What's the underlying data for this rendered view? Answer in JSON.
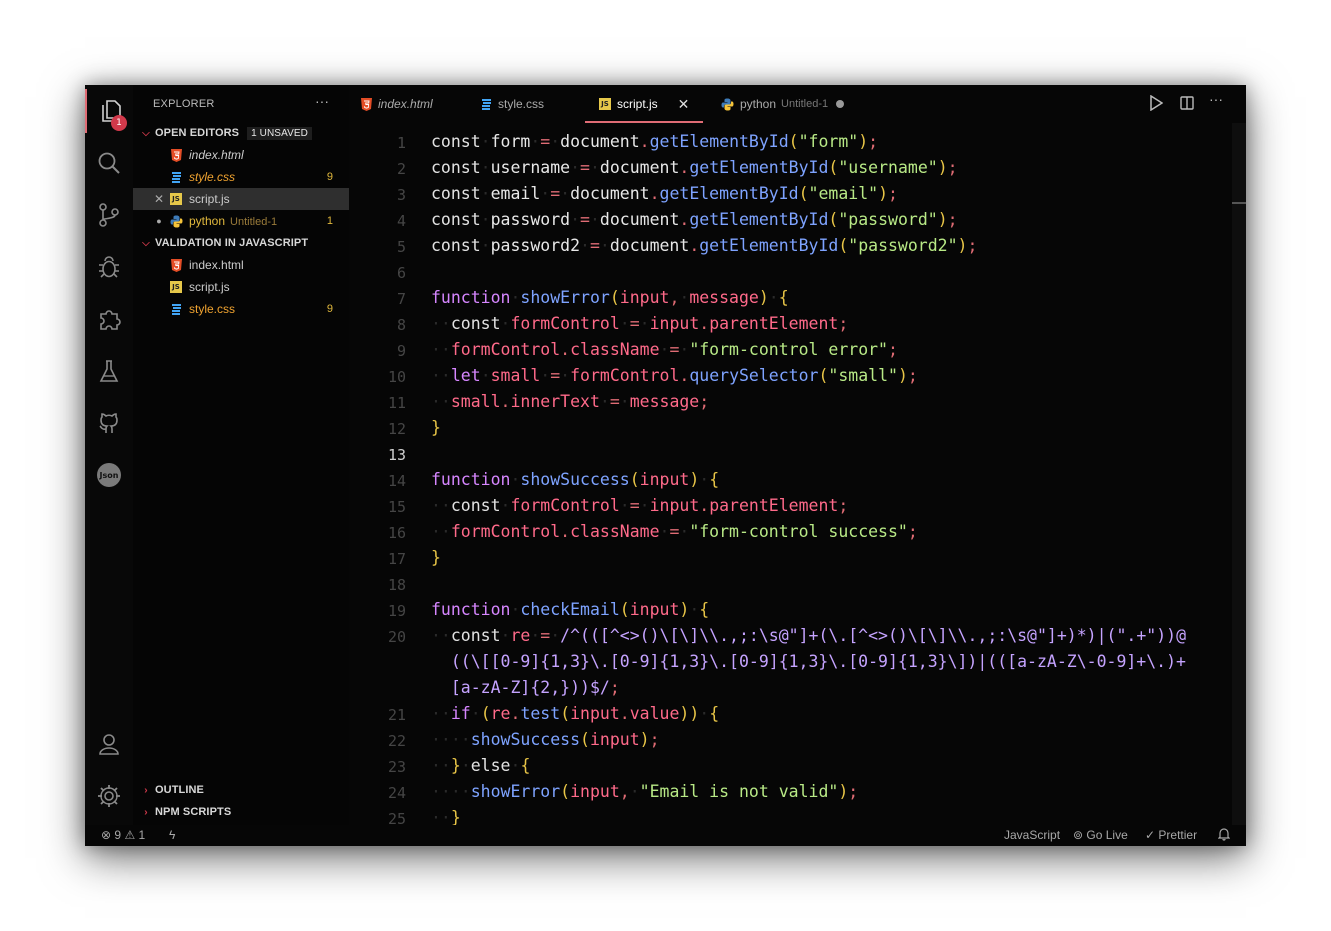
{
  "sidebar": {
    "title": "EXPLORER",
    "more": "···",
    "open_editors": {
      "label": "OPEN EDITORS",
      "unsaved": "1 UNSAVED",
      "items": [
        {
          "name": "index.html",
          "count": ""
        },
        {
          "name": "style.css",
          "count": "9"
        },
        {
          "name": "script.js",
          "count": ""
        },
        {
          "name": "python",
          "sub": "Untitled-1",
          "count": "1"
        }
      ]
    },
    "project": {
      "label": "VALIDATION IN JAVASCRIPT",
      "items": [
        {
          "name": "index.html",
          "count": ""
        },
        {
          "name": "script.js",
          "count": ""
        },
        {
          "name": "style.css",
          "count": "9"
        }
      ]
    },
    "outline": "OUTLINE",
    "npm": "NPM SCRIPTS"
  },
  "activity": {
    "badge": "1",
    "json_label": "Json"
  },
  "tabs": [
    {
      "name": "index.html"
    },
    {
      "name": "style.css"
    },
    {
      "name": "script.js",
      "close": "✕"
    },
    {
      "name": "python",
      "sub": "Untitled-1"
    }
  ],
  "toolbar": {
    "more": "···"
  },
  "editor": {
    "current_line": 13,
    "gutter": [
      "1",
      "2",
      "3",
      "4",
      "5",
      "6",
      "7",
      "8",
      "9",
      "10",
      "11",
      "12",
      "13",
      "14",
      "15",
      "16",
      "17",
      "18",
      "19",
      "20",
      "",
      "",
      "21",
      "22",
      "23",
      "24",
      "25"
    ],
    "lines": [
      [
        [
          "k",
          "const"
        ],
        [
          "ws",
          "·"
        ],
        [
          "e",
          "form"
        ],
        [
          "ws",
          "·"
        ],
        [
          "o",
          "="
        ],
        [
          "ws",
          "·"
        ],
        [
          "e",
          "document"
        ],
        [
          "o",
          "."
        ],
        [
          "m",
          "getElementById"
        ],
        [
          "p",
          "("
        ],
        [
          "s",
          "\"form\""
        ],
        [
          "p",
          ")"
        ],
        [
          "o",
          ";"
        ]
      ],
      [
        [
          "k",
          "const"
        ],
        [
          "ws",
          "·"
        ],
        [
          "e",
          "username"
        ],
        [
          "ws",
          "·"
        ],
        [
          "o",
          "="
        ],
        [
          "ws",
          "·"
        ],
        [
          "e",
          "document"
        ],
        [
          "o",
          "."
        ],
        [
          "m",
          "getElementById"
        ],
        [
          "p",
          "("
        ],
        [
          "s",
          "\"username\""
        ],
        [
          "p",
          ")"
        ],
        [
          "o",
          ";"
        ]
      ],
      [
        [
          "k",
          "const"
        ],
        [
          "ws",
          "·"
        ],
        [
          "e",
          "email"
        ],
        [
          "ws",
          "·"
        ],
        [
          "o",
          "="
        ],
        [
          "ws",
          "·"
        ],
        [
          "e",
          "document"
        ],
        [
          "o",
          "."
        ],
        [
          "m",
          "getElementById"
        ],
        [
          "p",
          "("
        ],
        [
          "s",
          "\"email\""
        ],
        [
          "p",
          ")"
        ],
        [
          "o",
          ";"
        ]
      ],
      [
        [
          "k",
          "const"
        ],
        [
          "ws",
          "·"
        ],
        [
          "e",
          "password"
        ],
        [
          "ws",
          "·"
        ],
        [
          "o",
          "="
        ],
        [
          "ws",
          "·"
        ],
        [
          "e",
          "document"
        ],
        [
          "o",
          "."
        ],
        [
          "m",
          "getElementById"
        ],
        [
          "p",
          "("
        ],
        [
          "s",
          "\"password\""
        ],
        [
          "p",
          ")"
        ],
        [
          "o",
          ";"
        ]
      ],
      [
        [
          "k",
          "const"
        ],
        [
          "ws",
          "·"
        ],
        [
          "e",
          "password2"
        ],
        [
          "ws",
          "·"
        ],
        [
          "o",
          "="
        ],
        [
          "ws",
          "·"
        ],
        [
          "e",
          "document"
        ],
        [
          "o",
          "."
        ],
        [
          "m",
          "getElementById"
        ],
        [
          "p",
          "("
        ],
        [
          "s",
          "\"password2\""
        ],
        [
          "p",
          ")"
        ],
        [
          "o",
          ";"
        ]
      ],
      [],
      [
        [
          "fn",
          "function"
        ],
        [
          "ws",
          "·"
        ],
        [
          "m",
          "showError"
        ],
        [
          "p",
          "("
        ],
        [
          "v",
          "input"
        ],
        [
          "o",
          ","
        ],
        [
          "ws",
          "·"
        ],
        [
          "v",
          "message"
        ],
        [
          "p",
          ")"
        ],
        [
          "ws",
          "·"
        ],
        [
          "p",
          "{"
        ]
      ],
      [
        [
          "ws",
          "··"
        ],
        [
          "k",
          "const"
        ],
        [
          "ws",
          "·"
        ],
        [
          "v",
          "formControl"
        ],
        [
          "ws",
          "·"
        ],
        [
          "o",
          "="
        ],
        [
          "ws",
          "·"
        ],
        [
          "v",
          "input"
        ],
        [
          "o",
          "."
        ],
        [
          "v",
          "parentElement"
        ],
        [
          "o",
          ";"
        ]
      ],
      [
        [
          "ws",
          "··"
        ],
        [
          "v",
          "formControl"
        ],
        [
          "o",
          "."
        ],
        [
          "v",
          "className"
        ],
        [
          "ws",
          "·"
        ],
        [
          "o",
          "="
        ],
        [
          "ws",
          "·"
        ],
        [
          "s",
          "\"form-control error\""
        ],
        [
          "o",
          ";"
        ]
      ],
      [
        [
          "ws",
          "··"
        ],
        [
          "fn",
          "let"
        ],
        [
          "ws",
          "·"
        ],
        [
          "v",
          "small"
        ],
        [
          "ws",
          "·"
        ],
        [
          "o",
          "="
        ],
        [
          "ws",
          "·"
        ],
        [
          "v",
          "formControl"
        ],
        [
          "o",
          "."
        ],
        [
          "m",
          "querySelector"
        ],
        [
          "p",
          "("
        ],
        [
          "s",
          "\"small\""
        ],
        [
          "p",
          ")"
        ],
        [
          "o",
          ";"
        ]
      ],
      [
        [
          "ws",
          "··"
        ],
        [
          "v",
          "small"
        ],
        [
          "o",
          "."
        ],
        [
          "v",
          "innerText"
        ],
        [
          "ws",
          "·"
        ],
        [
          "o",
          "="
        ],
        [
          "ws",
          "·"
        ],
        [
          "v",
          "message"
        ],
        [
          "o",
          ";"
        ]
      ],
      [
        [
          "p",
          "}"
        ]
      ],
      [],
      [
        [
          "fn",
          "function"
        ],
        [
          "ws",
          "·"
        ],
        [
          "m",
          "showSuccess"
        ],
        [
          "p",
          "("
        ],
        [
          "v",
          "input"
        ],
        [
          "p",
          ")"
        ],
        [
          "ws",
          "·"
        ],
        [
          "p",
          "{"
        ]
      ],
      [
        [
          "ws",
          "··"
        ],
        [
          "k",
          "const"
        ],
        [
          "ws",
          "·"
        ],
        [
          "v",
          "formControl"
        ],
        [
          "ws",
          "·"
        ],
        [
          "o",
          "="
        ],
        [
          "ws",
          "·"
        ],
        [
          "v",
          "input"
        ],
        [
          "o",
          "."
        ],
        [
          "v",
          "parentElement"
        ],
        [
          "o",
          ";"
        ]
      ],
      [
        [
          "ws",
          "··"
        ],
        [
          "v",
          "formControl"
        ],
        [
          "o",
          "."
        ],
        [
          "v",
          "className"
        ],
        [
          "ws",
          "·"
        ],
        [
          "o",
          "="
        ],
        [
          "ws",
          "·"
        ],
        [
          "s",
          "\"form-control success\""
        ],
        [
          "o",
          ";"
        ]
      ],
      [
        [
          "p",
          "}"
        ]
      ],
      [],
      [
        [
          "fn",
          "function"
        ],
        [
          "ws",
          "·"
        ],
        [
          "m",
          "checkEmail"
        ],
        [
          "p",
          "("
        ],
        [
          "v",
          "input"
        ],
        [
          "p",
          ")"
        ],
        [
          "ws",
          "·"
        ],
        [
          "p",
          "{"
        ]
      ],
      [
        [
          "ws",
          "··"
        ],
        [
          "k",
          "const"
        ],
        [
          "ws",
          "·"
        ],
        [
          "v",
          "re"
        ],
        [
          "ws",
          "·"
        ],
        [
          "o",
          "="
        ],
        [
          "ws",
          "·"
        ],
        [
          "r",
          "/^(([^<>()\\[\\]\\\\.,;:\\s@\"]+(\\.[^<>()\\[\\]\\\\.,;:\\s@\"]+)*)|(\".+\"))@"
        ]
      ],
      [
        [
          "ws",
          "  "
        ],
        [
          "r",
          "((\\[[0-9]{1,3}\\.[0-9]{1,3}\\.[0-9]{1,3}\\.[0-9]{1,3}\\])|(([a-zA-Z\\-0-9]+\\.)+"
        ]
      ],
      [
        [
          "ws",
          "  "
        ],
        [
          "r",
          "[a-zA-Z]{2,}))$/"
        ],
        [
          "o",
          ";"
        ]
      ],
      [
        [
          "ws",
          "··"
        ],
        [
          "fn",
          "if"
        ],
        [
          "ws",
          "·"
        ],
        [
          "p",
          "("
        ],
        [
          "v",
          "re"
        ],
        [
          "o",
          "."
        ],
        [
          "m",
          "test"
        ],
        [
          "p",
          "("
        ],
        [
          "v",
          "input"
        ],
        [
          "o",
          "."
        ],
        [
          "v",
          "value"
        ],
        [
          "p",
          "))"
        ],
        [
          "ws",
          "·"
        ],
        [
          "p",
          "{"
        ]
      ],
      [
        [
          "ws",
          "····"
        ],
        [
          "m",
          "showSuccess"
        ],
        [
          "p",
          "("
        ],
        [
          "v",
          "input"
        ],
        [
          "p",
          ")"
        ],
        [
          "o",
          ";"
        ]
      ],
      [
        [
          "ws",
          "··"
        ],
        [
          "p",
          "}"
        ],
        [
          "ws",
          "·"
        ],
        [
          "k",
          "else"
        ],
        [
          "ws",
          "·"
        ],
        [
          "p",
          "{"
        ]
      ],
      [
        [
          "ws",
          "····"
        ],
        [
          "m",
          "showError"
        ],
        [
          "p",
          "("
        ],
        [
          "v",
          "input"
        ],
        [
          "o",
          ","
        ],
        [
          "ws",
          "·"
        ],
        [
          "s",
          "\"Email is not valid\""
        ],
        [
          "p",
          ")"
        ],
        [
          "o",
          ";"
        ]
      ],
      [
        [
          "ws",
          "··"
        ],
        [
          "p",
          "}"
        ]
      ]
    ]
  },
  "status": {
    "errors": "9",
    "warnings": "1",
    "language": "JavaScript",
    "golive": "Go Live",
    "prettier": "Prettier"
  },
  "colors": {
    "accent": "#e06c75",
    "badge": "#d1394b",
    "background": "#060606"
  }
}
